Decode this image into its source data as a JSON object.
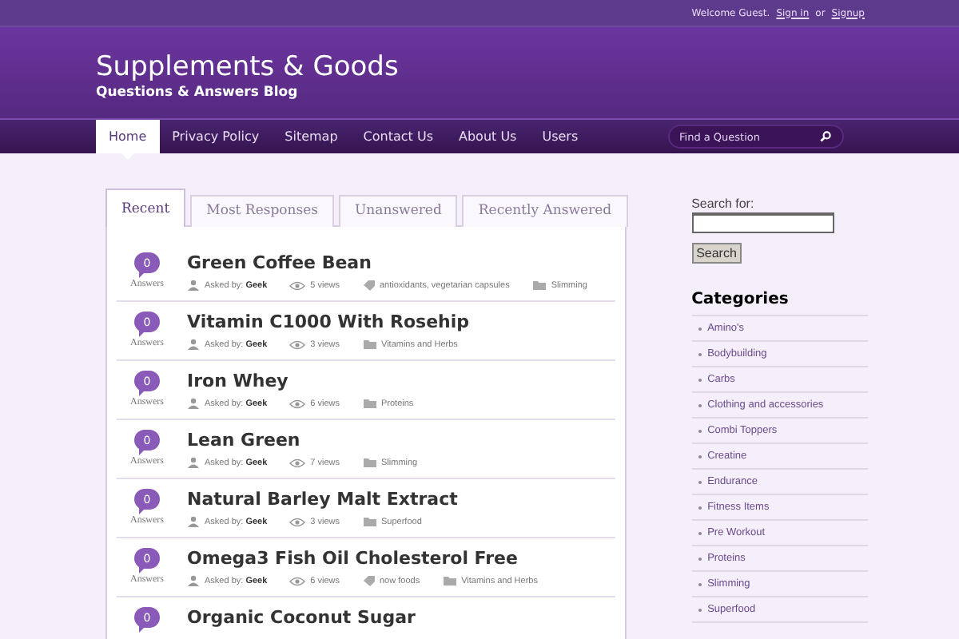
{
  "top_bar": {
    "welcome": "Welcome Guest.",
    "sign_in": "Sign in",
    "or": "or",
    "signup": "Signup"
  },
  "site": {
    "title": "Supplements & Goods",
    "tagline": "Questions & Answers Blog"
  },
  "nav": [
    {
      "label": "Home",
      "selected": true
    },
    {
      "label": "Privacy Policy",
      "selected": false
    },
    {
      "label": "Sitemap",
      "selected": false
    },
    {
      "label": "Contact Us",
      "selected": false
    },
    {
      "label": "About Us",
      "selected": false
    },
    {
      "label": "Users",
      "selected": false
    }
  ],
  "search": {
    "placeholder": "Find a Question"
  },
  "tabs": [
    {
      "label": "Recent",
      "selected": true
    },
    {
      "label": "Most Responses",
      "selected": false
    },
    {
      "label": "Unanswered",
      "selected": false
    },
    {
      "label": "Recently Answered",
      "selected": false
    }
  ],
  "questions": [
    {
      "count": "0",
      "count_label": "Answers",
      "title": "Green Coffee Bean",
      "meta": [
        {
          "kind": "author",
          "text": "Asked by: **Geek**"
        },
        {
          "kind": "views",
          "text": "5 views"
        },
        {
          "kind": "tags",
          "text": "antioxidants, vegetarian capsules"
        },
        {
          "kind": "category",
          "text": "Slimming"
        }
      ]
    },
    {
      "count": "0",
      "count_label": "Answers",
      "title": "Vitamin C1000 With Rosehip",
      "meta": [
        {
          "kind": "author",
          "text": "Asked by: **Geek**"
        },
        {
          "kind": "views",
          "text": "3 views"
        },
        {
          "kind": "category",
          "text": "Vitamins and Herbs"
        }
      ]
    },
    {
      "count": "0",
      "count_label": "Answers",
      "title": "Iron Whey",
      "meta": [
        {
          "kind": "author",
          "text": "Asked by: **Geek**"
        },
        {
          "kind": "views",
          "text": "6 views"
        },
        {
          "kind": "category",
          "text": "Proteins"
        }
      ]
    },
    {
      "count": "0",
      "count_label": "Answers",
      "title": "Lean Green",
      "meta": [
        {
          "kind": "author",
          "text": "Asked by: **Geek**"
        },
        {
          "kind": "views",
          "text": "7 views"
        },
        {
          "kind": "category",
          "text": "Slimming"
        }
      ]
    },
    {
      "count": "0",
      "count_label": "Answers",
      "title": "Natural Barley Malt Extract",
      "meta": [
        {
          "kind": "author",
          "text": "Asked by: **Geek**"
        },
        {
          "kind": "views",
          "text": "3 views"
        },
        {
          "kind": "category",
          "text": "Superfood"
        }
      ]
    },
    {
      "count": "0",
      "count_label": "Answers",
      "title": "Omega3 Fish Oil Cholesterol Free",
      "meta": [
        {
          "kind": "author",
          "text": "Asked by: **Geek**"
        },
        {
          "kind": "views",
          "text": "6 views"
        },
        {
          "kind": "tags",
          "text": "now foods"
        },
        {
          "kind": "category",
          "text": "Vitamins and Herbs"
        }
      ]
    },
    {
      "count": "0",
      "title": "Organic Coconut Sugar"
    }
  ],
  "sidebar": {
    "search_label": "Search for:",
    "search_button": "Search",
    "categories_title": "Categories",
    "categories": [
      "Amino's",
      "Bodybuilding",
      "Carbs",
      "Clothing and accessories",
      "Combi Toppers",
      "Creatine",
      "Endurance",
      "Fitness Items",
      "Pre Workout",
      "Proteins",
      "Slimming",
      "Superfood"
    ]
  }
}
